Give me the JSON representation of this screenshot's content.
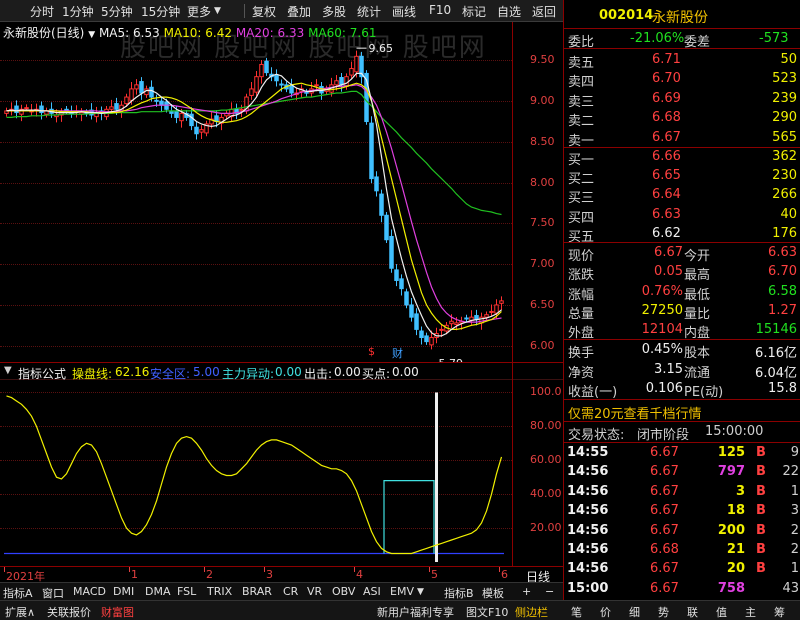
{
  "toolbar": {
    "items": [
      "分时",
      "1分钟",
      "5分钟",
      "15分钟",
      "更多",
      "复权",
      "叠加",
      "多股",
      "统计",
      "画线",
      "F10",
      "标记",
      "自选",
      "返回"
    ]
  },
  "main_chart": {
    "stock_name": "永新股份(日线)",
    "ma5": "MA5: 6.53",
    "ma10": "MA10: 6.42",
    "ma20": "MA20: 6.33",
    "ma60": "MA60: 7.61",
    "high_label": "9.65",
    "low_label": "5.79",
    "marker_dollar": "$",
    "marker_cai": "财",
    "watermark": "股吧网 股吧网 股吧网 股吧网"
  },
  "chart_data": [
    {
      "type": "candlestick",
      "title": "",
      "ylim": [
        5.8,
        9.75
      ],
      "y_ticks": [
        "9.50",
        "9.00",
        "8.50",
        "8.00",
        "7.50",
        "7.00",
        "6.50",
        "6.00"
      ],
      "y_values": [
        9.5,
        9.0,
        8.5,
        8.0,
        7.5,
        7.0,
        6.5,
        6.0
      ],
      "x_ticks": [
        "2021年",
        "1",
        "2",
        "3",
        "4",
        "5",
        "6"
      ],
      "x_tick_idx": [
        0,
        25,
        40,
        52,
        70,
        85,
        99
      ],
      "n": 100,
      "close": [
        8.88,
        8.9,
        8.86,
        8.9,
        8.92,
        8.88,
        8.9,
        8.86,
        8.88,
        8.85,
        8.83,
        8.86,
        8.88,
        8.85,
        8.88,
        8.86,
        8.85,
        8.83,
        8.86,
        8.85,
        8.9,
        8.93,
        8.9,
        8.95,
        9.05,
        9.15,
        9.2,
        9.1,
        9.15,
        9.05,
        9.0,
        8.95,
        8.9,
        8.85,
        8.8,
        8.85,
        8.8,
        8.7,
        8.6,
        8.65,
        8.72,
        8.78,
        8.75,
        8.8,
        8.85,
        8.9,
        8.85,
        8.9,
        9.05,
        9.15,
        9.3,
        9.45,
        9.35,
        9.3,
        9.25,
        9.2,
        9.15,
        9.1,
        9.1,
        9.15,
        9.1,
        9.15,
        9.2,
        9.1,
        9.15,
        9.2,
        9.25,
        9.2,
        9.3,
        9.4,
        9.55,
        9.3,
        8.75,
        8.05,
        7.9,
        7.6,
        7.3,
        6.95,
        6.8,
        6.7,
        6.5,
        6.35,
        6.2,
        6.1,
        6.05,
        6.1,
        6.15,
        6.2,
        6.25,
        6.3,
        6.28,
        6.3,
        6.33,
        6.35,
        6.32,
        6.35,
        6.38,
        6.42,
        6.5,
        6.55
      ],
      "ma5": [
        8.88,
        8.89,
        8.88,
        8.89,
        8.89,
        8.89,
        8.89,
        8.88,
        8.88,
        8.87,
        8.86,
        8.86,
        8.86,
        8.86,
        8.86,
        8.87,
        8.86,
        8.86,
        8.86,
        8.85,
        8.86,
        8.87,
        8.88,
        8.9,
        8.94,
        9.0,
        9.05,
        9.09,
        9.13,
        9.13,
        9.1,
        9.05,
        9.01,
        8.95,
        8.9,
        8.87,
        8.84,
        8.8,
        8.75,
        8.72,
        8.7,
        8.69,
        8.7,
        8.74,
        8.78,
        8.82,
        8.83,
        8.86,
        8.91,
        8.97,
        9.05,
        9.17,
        9.26,
        9.31,
        9.33,
        9.31,
        9.25,
        9.2,
        9.16,
        9.14,
        9.12,
        9.12,
        9.13,
        9.13,
        9.14,
        9.16,
        9.18,
        9.2,
        9.22,
        9.27,
        9.34,
        9.34,
        9.26,
        9.01,
        8.71,
        8.32,
        7.92,
        7.56,
        7.31,
        7.07,
        6.85,
        6.66,
        6.51,
        6.37,
        6.24,
        6.16,
        6.12,
        6.12,
        6.15,
        6.2,
        6.24,
        6.27,
        6.29,
        6.31,
        6.32,
        6.33,
        6.34,
        6.36,
        6.39,
        6.44
      ],
      "ma10": [
        8.88,
        8.88,
        8.88,
        8.88,
        8.88,
        8.88,
        8.88,
        8.88,
        8.88,
        8.88,
        8.88,
        8.87,
        8.87,
        8.87,
        8.87,
        8.87,
        8.87,
        8.86,
        8.86,
        8.86,
        8.86,
        8.86,
        8.86,
        8.87,
        8.89,
        8.92,
        8.95,
        8.98,
        9.0,
        9.03,
        9.04,
        9.05,
        9.05,
        9.04,
        9.02,
        8.99,
        8.95,
        8.91,
        8.86,
        8.82,
        8.79,
        8.77,
        8.75,
        8.74,
        8.74,
        8.75,
        8.76,
        8.78,
        8.81,
        8.85,
        8.9,
        8.95,
        9.0,
        9.05,
        9.1,
        9.15,
        9.18,
        9.2,
        9.21,
        9.22,
        9.2,
        9.19,
        9.17,
        9.15,
        9.14,
        9.14,
        9.15,
        9.16,
        9.18,
        9.2,
        9.22,
        9.2,
        9.15,
        9.0,
        8.8,
        8.55,
        8.3,
        8.05,
        7.8,
        7.55,
        7.3,
        7.05,
        6.85,
        6.65,
        6.5,
        6.4,
        6.32,
        6.26,
        6.22,
        6.2,
        6.2,
        6.21,
        6.23,
        6.25,
        6.26,
        6.28,
        6.3,
        6.32,
        6.36,
        6.42
      ],
      "ma20": [
        8.88,
        8.88,
        8.88,
        8.88,
        8.88,
        8.88,
        8.88,
        8.88,
        8.88,
        8.88,
        8.88,
        8.88,
        8.88,
        8.88,
        8.88,
        8.88,
        8.88,
        8.88,
        8.88,
        8.87,
        8.87,
        8.87,
        8.87,
        8.88,
        8.88,
        8.89,
        8.9,
        8.92,
        8.93,
        8.94,
        8.95,
        8.95,
        8.95,
        8.95,
        8.94,
        8.93,
        8.92,
        8.91,
        8.9,
        8.89,
        8.88,
        8.87,
        8.86,
        8.85,
        8.85,
        8.85,
        8.86,
        8.87,
        8.88,
        8.9,
        8.92,
        8.94,
        8.96,
        8.98,
        9.0,
        9.03,
        9.05,
        9.07,
        9.09,
        9.11,
        9.12,
        9.13,
        9.14,
        9.15,
        9.16,
        9.17,
        9.18,
        9.18,
        9.19,
        9.19,
        9.2,
        9.18,
        9.12,
        9.05,
        8.95,
        8.8,
        8.62,
        8.42,
        8.2,
        7.98,
        7.75,
        7.52,
        7.3,
        7.1,
        6.9,
        6.72,
        6.58,
        6.47,
        6.4,
        6.35,
        6.32,
        6.3,
        6.29,
        6.29,
        6.29,
        6.3,
        6.31,
        6.32,
        6.33,
        6.34
      ],
      "ma60": [
        8.8,
        8.8,
        8.81,
        8.81,
        8.81,
        8.82,
        8.82,
        8.82,
        8.83,
        8.83,
        8.83,
        8.84,
        8.84,
        8.84,
        8.84,
        8.84,
        8.84,
        8.85,
        8.85,
        8.85,
        8.85,
        8.85,
        8.86,
        8.86,
        8.86,
        8.86,
        8.86,
        8.87,
        8.87,
        8.87,
        8.87,
        8.87,
        8.88,
        8.88,
        8.88,
        8.88,
        8.88,
        8.88,
        8.88,
        8.88,
        8.88,
        8.88,
        8.88,
        8.89,
        8.89,
        8.9,
        8.91,
        8.92,
        8.93,
        8.94,
        8.95,
        8.96,
        8.97,
        8.98,
        8.99,
        9.0,
        9.01,
        9.02,
        9.03,
        9.04,
        9.05,
        9.05,
        9.06,
        9.07,
        9.08,
        9.09,
        9.1,
        9.1,
        9.11,
        9.12,
        9.12,
        9.08,
        9.0,
        8.94,
        8.87,
        8.8,
        8.74,
        8.68,
        8.62,
        8.55,
        8.49,
        8.43,
        8.36,
        8.3,
        8.24,
        8.17,
        8.11,
        8.05,
        7.99,
        7.93,
        7.86,
        7.8,
        7.74,
        7.7,
        7.68,
        7.66,
        7.65,
        7.64,
        7.62,
        7.61
      ],
      "high_idx": 70,
      "low_idx": 84
    },
    {
      "type": "line",
      "title": "",
      "ylim": [
        0,
        105
      ],
      "y_ticks": [
        "100.0",
        "80.00",
        "60.00",
        "40.00",
        "20.00"
      ],
      "y_values": [
        100,
        80,
        60,
        40,
        20
      ],
      "n": 100,
      "operation_line": [
        98,
        97,
        95,
        93,
        90,
        86,
        80,
        72,
        64,
        56,
        50,
        49,
        52,
        58,
        64,
        68,
        70,
        69,
        65,
        58,
        50,
        42,
        34,
        26,
        20,
        17,
        16,
        18,
        22,
        28,
        36,
        46,
        56,
        64,
        70,
        73,
        74,
        73,
        70,
        66,
        61,
        57,
        54,
        52,
        51,
        51,
        52,
        55,
        58,
        62,
        66,
        69,
        71,
        72,
        72,
        71,
        70,
        69,
        67,
        65,
        63,
        61,
        59,
        57,
        56,
        55,
        55,
        54,
        52,
        48,
        42,
        34,
        26,
        18,
        12,
        8,
        6,
        5,
        5,
        5,
        5,
        5,
        6,
        7,
        8,
        9,
        10,
        11,
        12,
        13,
        14,
        15,
        16,
        17,
        19,
        23,
        30,
        40,
        52,
        62
      ],
      "safe_zone": 5,
      "main_force_start": 76,
      "main_force_end": 86,
      "main_force_level": 48,
      "spike_idx": 86,
      "spike_level": 100
    }
  ],
  "indicator": {
    "name": "指标公式",
    "op_line_label": "操盘线:",
    "op_line_value": "62.16",
    "safe_zone_label": "安全区:",
    "safe_zone_value": "5.00",
    "main_force_label": "主力异动:",
    "main_force_value": "0.00",
    "exit_label": "出击:",
    "exit_value": "0.00",
    "buy_label": "买点:",
    "buy_value": "0.00"
  },
  "date_bar": {
    "period_label": "日线"
  },
  "tabs": {
    "items": [
      "指标A",
      "窗口",
      "MACD",
      "DMI",
      "DMA",
      "FSL",
      "TRIX",
      "BRAR",
      "CR",
      "VR",
      "OBV",
      "ASI",
      "EMV",
      "指标B",
      "模板",
      "+",
      "−"
    ]
  },
  "status_bar": {
    "left": [
      "扩展∧",
      "关联报价",
      "财富图"
    ],
    "right": [
      "新用户福利专享",
      "图文F10",
      "侧边栏"
    ],
    "panel_buttons": [
      "笔",
      "价",
      "细",
      "势",
      "联",
      "值",
      "主",
      "筹"
    ]
  },
  "quote": {
    "code": "002014",
    "name": "永新股份",
    "weibi_label": "委比",
    "weibi_value": "-21.06%",
    "weicha_label": "委差",
    "weicha_value": "-573",
    "sell": [
      {
        "label": "卖五",
        "price": "6.71",
        "vol": "50"
      },
      {
        "label": "卖四",
        "price": "6.70",
        "vol": "523"
      },
      {
        "label": "卖三",
        "price": "6.69",
        "vol": "239"
      },
      {
        "label": "卖二",
        "price": "6.68",
        "vol": "290"
      },
      {
        "label": "卖一",
        "price": "6.67",
        "vol": "565"
      }
    ],
    "buy": [
      {
        "label": "买一",
        "price": "6.66",
        "vol": "362"
      },
      {
        "label": "买二",
        "price": "6.65",
        "vol": "230"
      },
      {
        "label": "买三",
        "price": "6.64",
        "vol": "266"
      },
      {
        "label": "买四",
        "price": "6.63",
        "vol": "40"
      },
      {
        "label": "买五",
        "price": "6.62",
        "vol": "176"
      }
    ],
    "stats1": [
      {
        "l1": "现价",
        "v1": "6.67",
        "l2": "今开",
        "v2": "6.63"
      },
      {
        "l1": "涨跌",
        "v1": "0.05",
        "l2": "最高",
        "v2": "6.70"
      },
      {
        "l1": "涨幅",
        "v1": "0.76%",
        "l2": "最低",
        "v2": "6.58"
      },
      {
        "l1": "总量",
        "v1": "27250",
        "l2": "量比",
        "v2": "1.27"
      },
      {
        "l1": "外盘",
        "v1": "12104",
        "l2": "内盘",
        "v2": "15146"
      }
    ],
    "stats2": [
      {
        "l1": "换手",
        "v1": "0.45%",
        "l2": "股本",
        "v2": "6.16亿"
      },
      {
        "l1": "净资",
        "v1": "3.15",
        "l2": "流通",
        "v2": "6.04亿"
      },
      {
        "l1": "收益(一)",
        "v1": "0.106",
        "l2": "PE(动)",
        "v2": "15.8"
      }
    ],
    "promo": "仅需20元查看千档行情",
    "trade_status_label": "交易状态:",
    "trade_status_value": "闭市阶段",
    "trade_status_time": "15:00:00",
    "ticks": [
      {
        "time": "14:55",
        "price": "6.67",
        "vol": "125",
        "side": "B",
        "extra": "9"
      },
      {
        "time": "14:56",
        "price": "6.67",
        "vol": "797",
        "side": "B",
        "extra": "22"
      },
      {
        "time": "14:56",
        "price": "6.67",
        "vol": "3",
        "side": "B",
        "extra": "1"
      },
      {
        "time": "14:56",
        "price": "6.67",
        "vol": "18",
        "side": "B",
        "extra": "3"
      },
      {
        "time": "14:56",
        "price": "6.67",
        "vol": "200",
        "side": "B",
        "extra": "2"
      },
      {
        "time": "14:56",
        "price": "6.68",
        "vol": "21",
        "side": "B",
        "extra": "2"
      },
      {
        "time": "14:56",
        "price": "6.67",
        "vol": "20",
        "side": "B",
        "extra": "1"
      },
      {
        "time": "15:00",
        "price": "6.67",
        "vol": "758",
        "side": "",
        "extra": "43"
      }
    ]
  }
}
